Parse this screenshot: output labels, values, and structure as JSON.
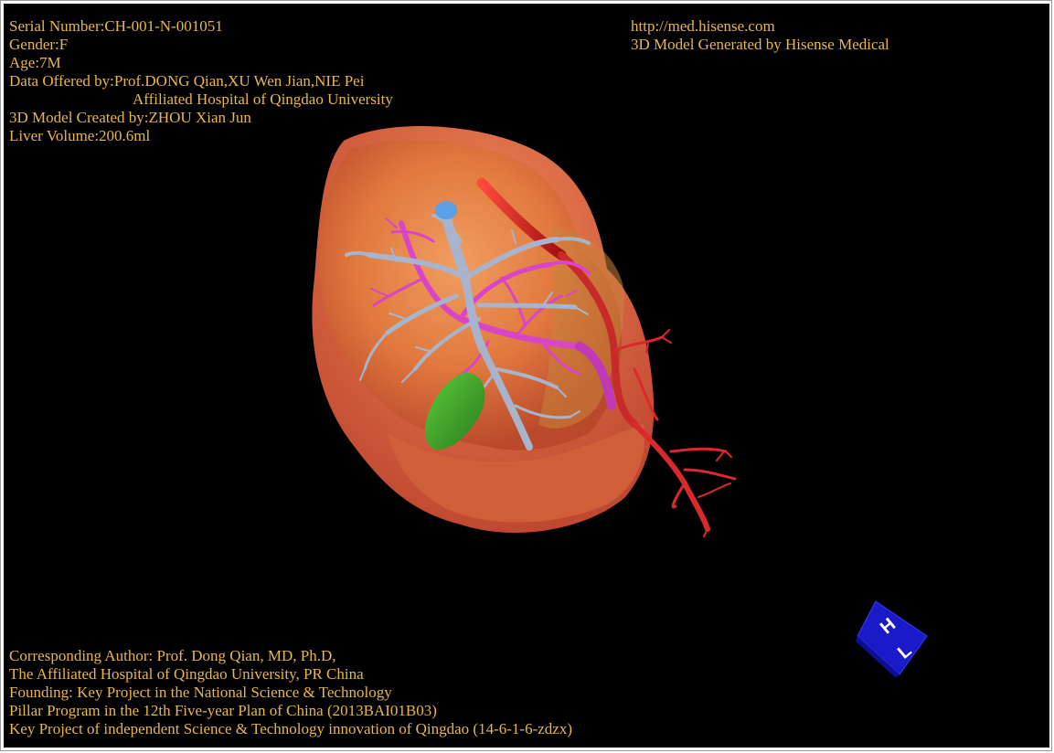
{
  "header_left": {
    "serial": "Serial Number:CH-001-N-001051",
    "gender": "Gender:F",
    "age": "Age:7M",
    "data_offered": "Data Offered by:Prof.DONG Qian,XU Wen Jian,NIE Pei",
    "hospital": "Affiliated Hospital of Qingdao University",
    "created_by": "3D Model Created by:ZHOU Xian Jun",
    "volume": "Liver Volume:200.6ml"
  },
  "header_right": {
    "url": "http://med.hisense.com",
    "generated": "3D Model Generated by Hisense Medical"
  },
  "footer": {
    "author": "Corresponding Author: Prof. Dong Qian, MD, Ph.D,",
    "affiliation": "The Affiliated Hospital of Qingdao University, PR China",
    "founding": "Founding: Key Project in the National Science & Technology",
    "pillar": "Pillar Program in the 12th Five-year Plan of China (2013BAI01B03)",
    "key_project": "Key Project of independent Science & Technology innovation of Qingdao (14-6-1-6-zdzx)"
  },
  "orientation_cube": {
    "label_top": "H",
    "label_bottom": "L",
    "color": "#1a1ac8"
  },
  "colors": {
    "text": "#e8b64a",
    "background": "#000000",
    "liver": "#e0703a",
    "portal_vein": "#a8b4cc",
    "hepatic_vein": "#d845c8",
    "artery": "#d82020",
    "gallbladder": "#3aa02a"
  },
  "model": {
    "structures": [
      "liver",
      "portal-vein",
      "hepatic-vein",
      "hepatic-artery",
      "gallbladder"
    ]
  }
}
